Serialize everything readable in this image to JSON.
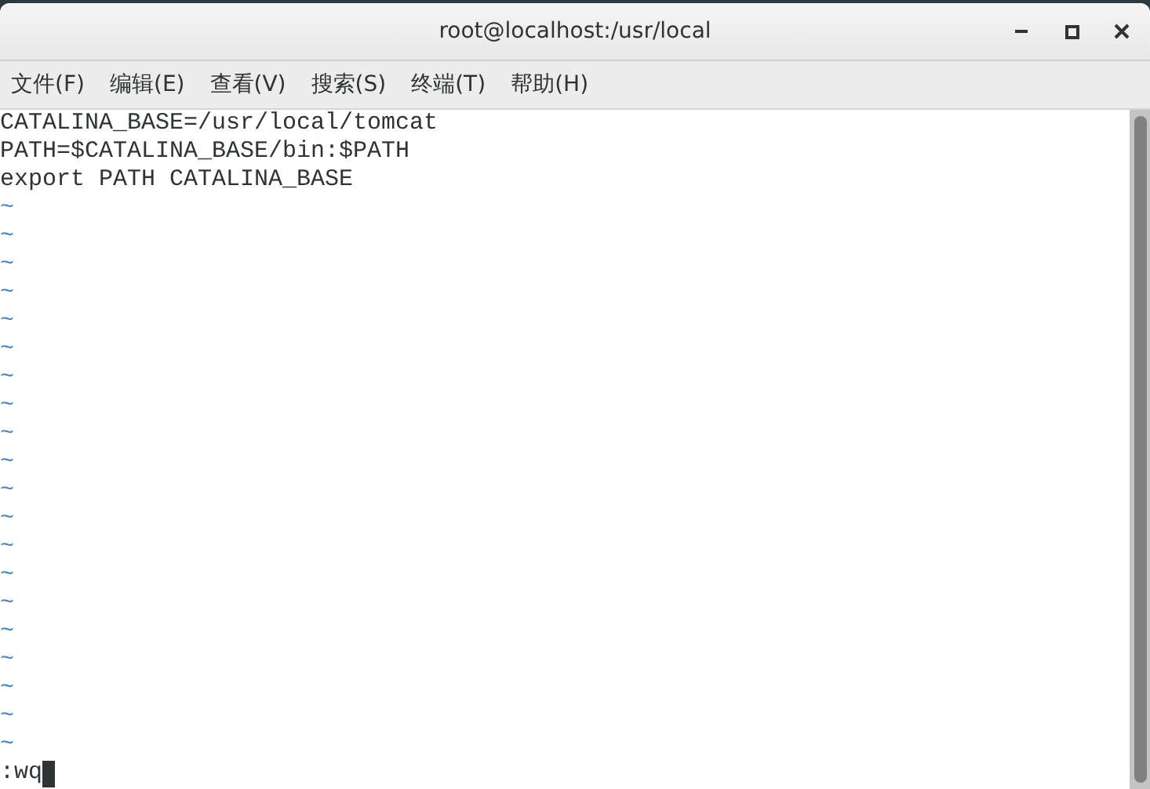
{
  "window": {
    "title": "root@localhost:/usr/local"
  },
  "menu": [
    "文件(F)",
    "编辑(E)",
    "查看(V)",
    "搜索(S)",
    "终端(T)",
    "帮助(H)"
  ],
  "editor": {
    "lines": [
      {
        "kind": "text",
        "text": "CATALINA_BASE=/usr/local/tomcat"
      },
      {
        "kind": "text",
        "text": "PATH=$CATALINA_BASE/bin:$PATH"
      },
      {
        "kind": "text",
        "text": "export PATH CATALINA_BASE"
      },
      {
        "kind": "empty",
        "text": "~"
      },
      {
        "kind": "empty",
        "text": "~"
      },
      {
        "kind": "empty",
        "text": "~"
      },
      {
        "kind": "empty",
        "text": "~"
      },
      {
        "kind": "empty",
        "text": "~"
      },
      {
        "kind": "empty",
        "text": "~"
      },
      {
        "kind": "empty",
        "text": "~"
      },
      {
        "kind": "empty",
        "text": "~"
      },
      {
        "kind": "empty",
        "text": "~"
      },
      {
        "kind": "empty",
        "text": "~"
      },
      {
        "kind": "empty",
        "text": "~"
      },
      {
        "kind": "empty",
        "text": "~"
      },
      {
        "kind": "empty",
        "text": "~"
      },
      {
        "kind": "empty",
        "text": "~"
      },
      {
        "kind": "empty",
        "text": "~"
      },
      {
        "kind": "empty",
        "text": "~"
      },
      {
        "kind": "empty",
        "text": "~"
      },
      {
        "kind": "empty",
        "text": "~"
      },
      {
        "kind": "empty",
        "text": "~"
      },
      {
        "kind": "empty",
        "text": "~"
      }
    ],
    "command": ":wq"
  }
}
